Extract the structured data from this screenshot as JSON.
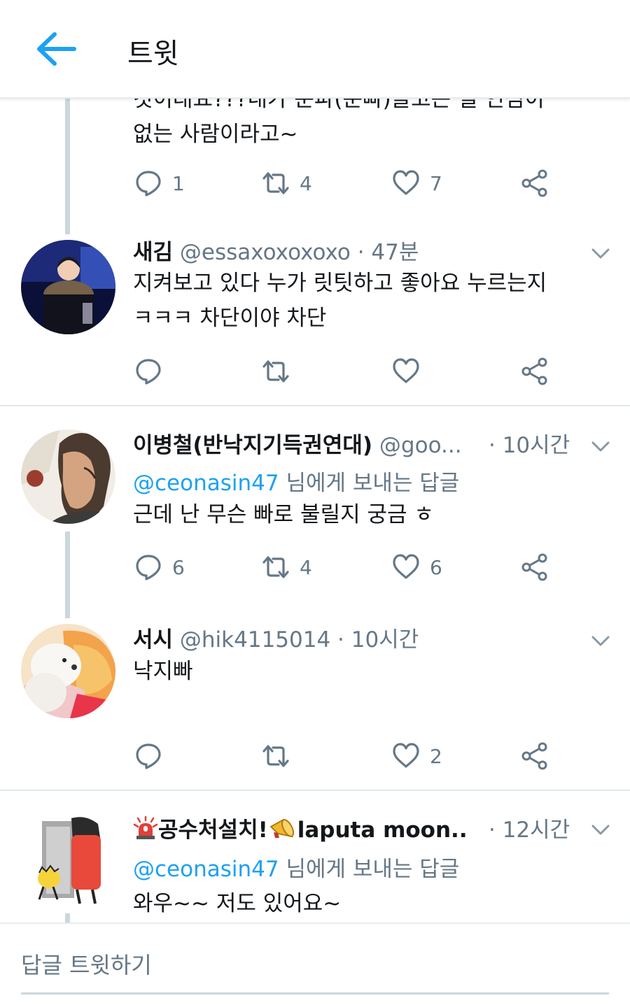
{
  "header": {
    "title": "트윗",
    "back_icon": "arrow-left-icon"
  },
  "colors": {
    "accent": "#1da1f2",
    "text": "#14171a",
    "muted": "#657786",
    "border": "#e1e8ed",
    "thread_line": "#ccd6dd"
  },
  "tweets": [
    {
      "text_lines": [
        "것이래요???내가 문파(문빠)들고는 될 인심이",
        "없는 사람이라고~"
      ],
      "actions": {
        "reply": "1",
        "retweet": "4",
        "like": "7"
      }
    },
    {
      "name": "새김",
      "handle": "@essaxoxoxoxo",
      "time": "· 47분",
      "text_lines": [
        "지켜보고 있다 누가 릿팃하고 좋아요 누르는지",
        "ㅋㅋㅋ 차단이야 차단"
      ],
      "actions": {
        "reply": "",
        "retweet": "",
        "like": ""
      }
    },
    {
      "name": "이병철(반낙지기득권연대)",
      "handle": "@goo...",
      "time": "· 10시간",
      "reply_mention": "@ceonasin47",
      "reply_suffix": " 님에게 보내는 답글",
      "text_lines": [
        "근데 난 무슨 빠로 불릴지 궁금 ㅎ"
      ],
      "actions": {
        "reply": "6",
        "retweet": "4",
        "like": "6"
      }
    },
    {
      "name": "서시",
      "handle": "@hik4115014",
      "time": "· 10시간",
      "text_lines": [
        "낙지빠"
      ],
      "actions": {
        "reply": "",
        "retweet": "",
        "like": "2"
      }
    },
    {
      "name": "공수처설치!",
      "name_suffix": "laputa moon...",
      "time": "· 12시간",
      "reply_mention": "@ceonasin47",
      "reply_suffix": " 님에게 보내는 답글",
      "text_lines": [
        "와우~~ 저도 있어요~"
      ]
    }
  ],
  "compose": {
    "placeholder": "답글 트윗하기"
  }
}
